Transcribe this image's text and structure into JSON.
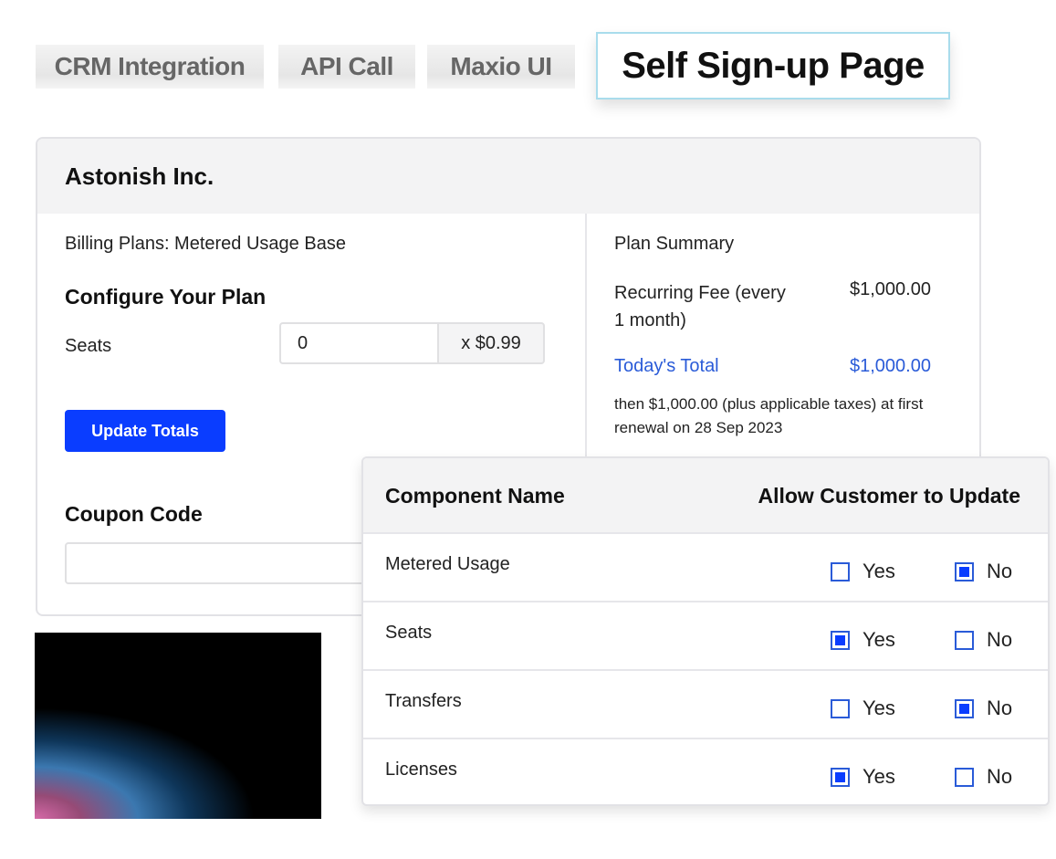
{
  "tabs": [
    {
      "label": "CRM Integration",
      "active": false
    },
    {
      "label": "API Call",
      "active": false
    },
    {
      "label": "Maxio UI",
      "active": false
    },
    {
      "label": "Self Sign-up Page",
      "active": true
    }
  ],
  "card": {
    "company": "Astonish Inc.",
    "billing_plan": "Billing Plans: Metered Usage Base",
    "configure_title": "Configure Your Plan",
    "seats_label": "Seats",
    "seats_value": "0",
    "seats_unit_price": "x $0.99",
    "update_button": "Update Totals",
    "coupon_label": "Coupon Code",
    "coupon_value": ""
  },
  "summary": {
    "title": "Plan Summary",
    "recurring_fee_label": "Recurring Fee (every 1 month)",
    "recurring_fee_value": "$1,000.00",
    "today_total_label": "Today's Total",
    "today_total_value": "$1,000.00",
    "renewal_note": "then $1,000.00 (plus applicable taxes) at first renewal on 28 Sep 2023"
  },
  "components_table": {
    "header_name": "Component Name",
    "header_allow": "Allow Customer to Update",
    "yes_label": "Yes",
    "no_label": "No",
    "rows": [
      {
        "name": "Metered Usage",
        "allow": "No"
      },
      {
        "name": "Seats",
        "allow": "Yes"
      },
      {
        "name": "Transfers",
        "allow": "No"
      },
      {
        "name": "Licenses",
        "allow": "Yes"
      }
    ]
  },
  "colors": {
    "accent": "#0a3dff",
    "link_blue": "#2a5bd8",
    "active_tab_border": "#a9dcec"
  }
}
